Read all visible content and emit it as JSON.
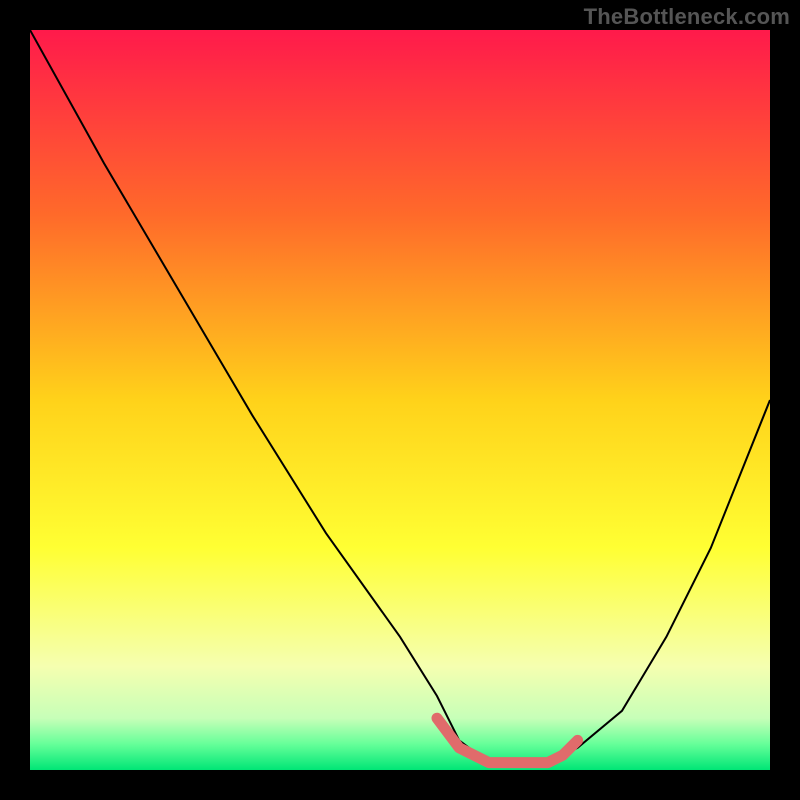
{
  "watermark": "TheBottleneck.com",
  "chart_data": {
    "type": "line",
    "title": "",
    "xlabel": "",
    "ylabel": "",
    "xlim": [
      0,
      100
    ],
    "ylim": [
      0,
      100
    ],
    "grid": false,
    "legend": false,
    "gradient": {
      "stops": [
        {
          "offset": 0.0,
          "color": "#ff1a4b"
        },
        {
          "offset": 0.25,
          "color": "#ff6a2a"
        },
        {
          "offset": 0.5,
          "color": "#ffd21a"
        },
        {
          "offset": 0.7,
          "color": "#ffff33"
        },
        {
          "offset": 0.86,
          "color": "#f5ffb0"
        },
        {
          "offset": 0.93,
          "color": "#c7ffb8"
        },
        {
          "offset": 0.965,
          "color": "#66ff99"
        },
        {
          "offset": 1.0,
          "color": "#00e676"
        }
      ]
    },
    "series": [
      {
        "name": "bottleneck-curve",
        "stroke": "#000000",
        "stroke_width": 2,
        "x": [
          0,
          10,
          20,
          30,
          40,
          50,
          55,
          58,
          62,
          66,
          70,
          74,
          80,
          86,
          92,
          100
        ],
        "y": [
          100,
          82,
          65,
          48,
          32,
          18,
          10,
          4,
          1,
          1,
          1,
          3,
          8,
          18,
          30,
          50
        ]
      }
    ],
    "flat_segment": {
      "color": "#e06b6b",
      "stroke_width": 11,
      "x": [
        55,
        58,
        60,
        62,
        64,
        66,
        68,
        70,
        72,
        74
      ],
      "y": [
        7,
        3,
        2,
        1,
        1,
        1,
        1,
        1,
        2,
        4
      ]
    }
  }
}
